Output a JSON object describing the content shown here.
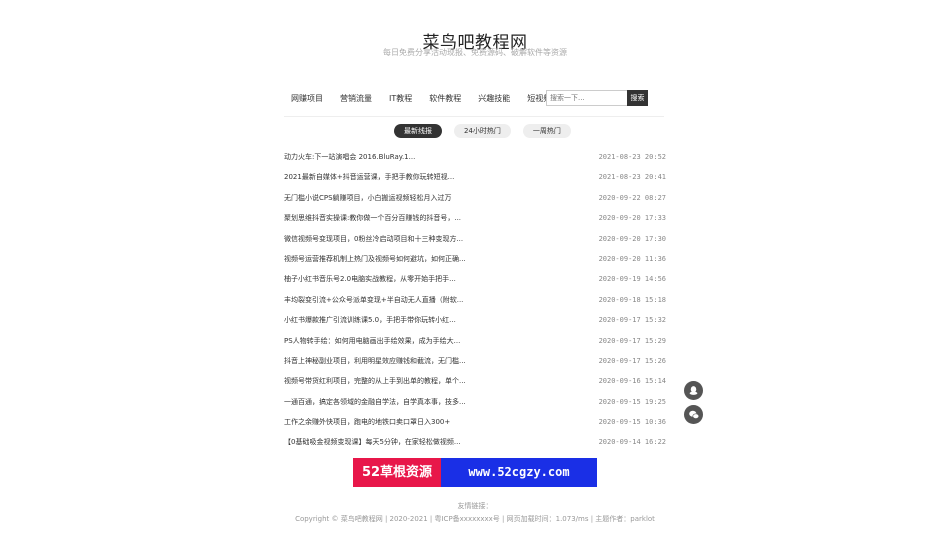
{
  "site": {
    "title": "菜鸟吧教程网",
    "subtitle": "每日免费分享活动现报、免费源码、破解软件等资源"
  },
  "nav": [
    "网赚项目",
    "营销流量",
    "IT教程",
    "软件教程",
    "兴趣技能",
    "短视频"
  ],
  "search": {
    "placeholder": "搜索一下...",
    "button": "搜索"
  },
  "tabs": [
    {
      "label": "最新线报",
      "active": true
    },
    {
      "label": "24小时热门",
      "active": false
    },
    {
      "label": "一周热门",
      "active": false
    }
  ],
  "articles": [
    {
      "title": "动力火车:下一站演唱会 2016.BluRay.1...",
      "time": "2021-08-23 20:52"
    },
    {
      "title": "2021最新自媒体+抖音运营课，手把手教你玩转短视...",
      "time": "2021-08-23 20:41"
    },
    {
      "title": "无门槛小说CPS躺赚项目，小白搬运视频轻松月入过万",
      "time": "2020-09-22 08:27"
    },
    {
      "title": "聚划思维抖音实操课:教你做一个百分百赚钱的抖音号，...",
      "time": "2020-09-20 17:33"
    },
    {
      "title": "微信视频号变现项目，0粉丝冷启动项目和十三种变现方...",
      "time": "2020-09-20 17:30"
    },
    {
      "title": "视频号运营推荐机制上热门及视频号如何避坑，如何正确...",
      "time": "2020-09-20 11:36"
    },
    {
      "title": "柚子小红书音乐号2.0电脑实战教程，从零开始手把手...",
      "time": "2020-09-19 14:56"
    },
    {
      "title": "丰均裂变引流+公众号派单变现+半自动无人直播（附软...",
      "time": "2020-09-18 15:18"
    },
    {
      "title": "小红书爆款推广引流训练课5.0，手把手带你玩转小红...",
      "time": "2020-09-17 15:32"
    },
    {
      "title": "PS人物转手绘：如何用电脑画出手绘效果，成为手绘大...",
      "time": "2020-09-17 15:29"
    },
    {
      "title": "抖音上神秘副业项目，利用明星效应赚钱和截流，无门槛...",
      "time": "2020-09-17 15:26"
    },
    {
      "title": "视频号带货红利项目，完整的从上手到出单的教程，单个...",
      "time": "2020-09-16 15:14"
    },
    {
      "title": "一通百通，搞定各领域的金融自学法，自学真本事，技多...",
      "time": "2020-09-15 19:25"
    },
    {
      "title": "工作之余赚外快项目，跑电的地铁口卖口罩日入300+",
      "time": "2020-09-15 10:36"
    },
    {
      "title": "【0基础吸金视频变现课】每天5分钟，在家轻松做视频...",
      "time": "2020-09-14 16:22"
    }
  ],
  "banner": {
    "left": "52草根资源",
    "right": "www.52cgzy.com",
    "left_color": "#e8174a",
    "right_color": "#1a2fe6"
  },
  "footer": {
    "links_label": "友情链接：",
    "copyright": "Copyright © 菜鸟吧教程网 | 2020-2021 | 粤ICP备xxxxxxxx号 | 网页加载时间：1.073/ms | 主题作者：parklot"
  },
  "float_icons": [
    "qq-icon",
    "wechat-icon"
  ]
}
